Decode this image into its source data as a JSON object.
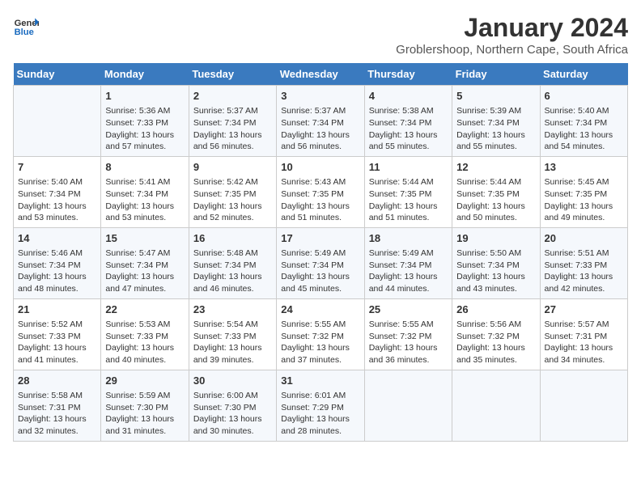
{
  "logo": {
    "line1": "General",
    "line2": "Blue"
  },
  "title": "January 2024",
  "subtitle": "Groblershoop, Northern Cape, South Africa",
  "days_of_week": [
    "Sunday",
    "Monday",
    "Tuesday",
    "Wednesday",
    "Thursday",
    "Friday",
    "Saturday"
  ],
  "weeks": [
    [
      {
        "day": "",
        "info": ""
      },
      {
        "day": "1",
        "info": "Sunrise: 5:36 AM\nSunset: 7:33 PM\nDaylight: 13 hours\nand 57 minutes."
      },
      {
        "day": "2",
        "info": "Sunrise: 5:37 AM\nSunset: 7:34 PM\nDaylight: 13 hours\nand 56 minutes."
      },
      {
        "day": "3",
        "info": "Sunrise: 5:37 AM\nSunset: 7:34 PM\nDaylight: 13 hours\nand 56 minutes."
      },
      {
        "day": "4",
        "info": "Sunrise: 5:38 AM\nSunset: 7:34 PM\nDaylight: 13 hours\nand 55 minutes."
      },
      {
        "day": "5",
        "info": "Sunrise: 5:39 AM\nSunset: 7:34 PM\nDaylight: 13 hours\nand 55 minutes."
      },
      {
        "day": "6",
        "info": "Sunrise: 5:40 AM\nSunset: 7:34 PM\nDaylight: 13 hours\nand 54 minutes."
      }
    ],
    [
      {
        "day": "7",
        "info": "Sunrise: 5:40 AM\nSunset: 7:34 PM\nDaylight: 13 hours\nand 53 minutes."
      },
      {
        "day": "8",
        "info": "Sunrise: 5:41 AM\nSunset: 7:34 PM\nDaylight: 13 hours\nand 53 minutes."
      },
      {
        "day": "9",
        "info": "Sunrise: 5:42 AM\nSunset: 7:35 PM\nDaylight: 13 hours\nand 52 minutes."
      },
      {
        "day": "10",
        "info": "Sunrise: 5:43 AM\nSunset: 7:35 PM\nDaylight: 13 hours\nand 51 minutes."
      },
      {
        "day": "11",
        "info": "Sunrise: 5:44 AM\nSunset: 7:35 PM\nDaylight: 13 hours\nand 51 minutes."
      },
      {
        "day": "12",
        "info": "Sunrise: 5:44 AM\nSunset: 7:35 PM\nDaylight: 13 hours\nand 50 minutes."
      },
      {
        "day": "13",
        "info": "Sunrise: 5:45 AM\nSunset: 7:35 PM\nDaylight: 13 hours\nand 49 minutes."
      }
    ],
    [
      {
        "day": "14",
        "info": "Sunrise: 5:46 AM\nSunset: 7:34 PM\nDaylight: 13 hours\nand 48 minutes."
      },
      {
        "day": "15",
        "info": "Sunrise: 5:47 AM\nSunset: 7:34 PM\nDaylight: 13 hours\nand 47 minutes."
      },
      {
        "day": "16",
        "info": "Sunrise: 5:48 AM\nSunset: 7:34 PM\nDaylight: 13 hours\nand 46 minutes."
      },
      {
        "day": "17",
        "info": "Sunrise: 5:49 AM\nSunset: 7:34 PM\nDaylight: 13 hours\nand 45 minutes."
      },
      {
        "day": "18",
        "info": "Sunrise: 5:49 AM\nSunset: 7:34 PM\nDaylight: 13 hours\nand 44 minutes."
      },
      {
        "day": "19",
        "info": "Sunrise: 5:50 AM\nSunset: 7:34 PM\nDaylight: 13 hours\nand 43 minutes."
      },
      {
        "day": "20",
        "info": "Sunrise: 5:51 AM\nSunset: 7:33 PM\nDaylight: 13 hours\nand 42 minutes."
      }
    ],
    [
      {
        "day": "21",
        "info": "Sunrise: 5:52 AM\nSunset: 7:33 PM\nDaylight: 13 hours\nand 41 minutes."
      },
      {
        "day": "22",
        "info": "Sunrise: 5:53 AM\nSunset: 7:33 PM\nDaylight: 13 hours\nand 40 minutes."
      },
      {
        "day": "23",
        "info": "Sunrise: 5:54 AM\nSunset: 7:33 PM\nDaylight: 13 hours\nand 39 minutes."
      },
      {
        "day": "24",
        "info": "Sunrise: 5:55 AM\nSunset: 7:32 PM\nDaylight: 13 hours\nand 37 minutes."
      },
      {
        "day": "25",
        "info": "Sunrise: 5:55 AM\nSunset: 7:32 PM\nDaylight: 13 hours\nand 36 minutes."
      },
      {
        "day": "26",
        "info": "Sunrise: 5:56 AM\nSunset: 7:32 PM\nDaylight: 13 hours\nand 35 minutes."
      },
      {
        "day": "27",
        "info": "Sunrise: 5:57 AM\nSunset: 7:31 PM\nDaylight: 13 hours\nand 34 minutes."
      }
    ],
    [
      {
        "day": "28",
        "info": "Sunrise: 5:58 AM\nSunset: 7:31 PM\nDaylight: 13 hours\nand 32 minutes."
      },
      {
        "day": "29",
        "info": "Sunrise: 5:59 AM\nSunset: 7:30 PM\nDaylight: 13 hours\nand 31 minutes."
      },
      {
        "day": "30",
        "info": "Sunrise: 6:00 AM\nSunset: 7:30 PM\nDaylight: 13 hours\nand 30 minutes."
      },
      {
        "day": "31",
        "info": "Sunrise: 6:01 AM\nSunset: 7:29 PM\nDaylight: 13 hours\nand 28 minutes."
      },
      {
        "day": "",
        "info": ""
      },
      {
        "day": "",
        "info": ""
      },
      {
        "day": "",
        "info": ""
      }
    ]
  ]
}
